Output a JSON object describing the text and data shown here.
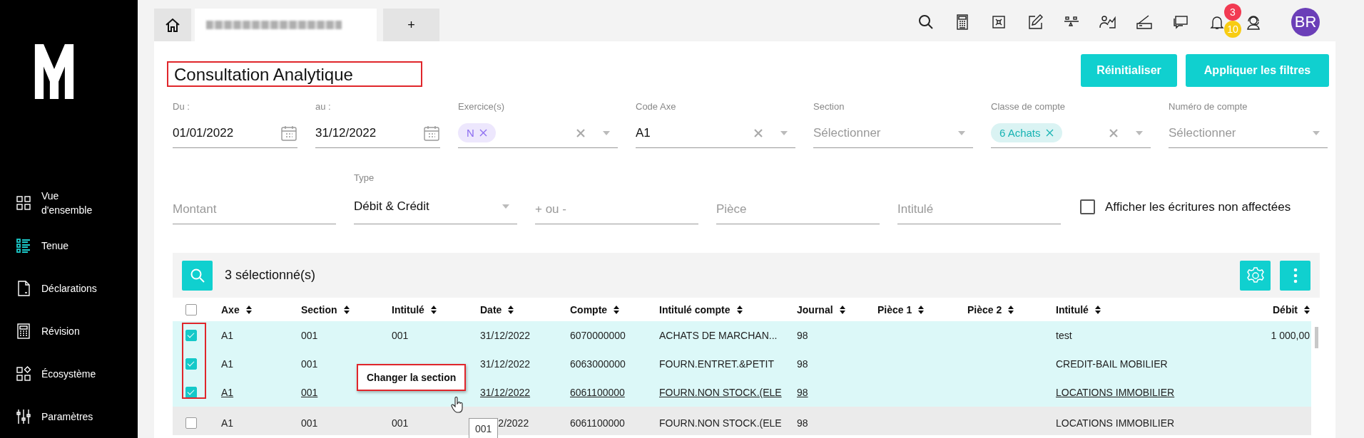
{
  "sidebar": {
    "nav": [
      {
        "label": "Vue d'ensemble",
        "selected": false
      },
      {
        "label": "Tenue",
        "selected": true
      },
      {
        "label": "Déclarations",
        "selected": false
      },
      {
        "label": "Révision",
        "selected": false
      },
      {
        "label": "Écosystème",
        "selected": false
      },
      {
        "label": "Paramètres",
        "selected": false
      }
    ]
  },
  "tabs": [
    {
      "kind": "home",
      "selected": false
    },
    {
      "kind": "document",
      "selected": true
    },
    {
      "kind": "new",
      "label": "+",
      "selected": false
    }
  ],
  "toolbar": {
    "notifications": [
      {
        "count": "3",
        "color": "#f23a52"
      },
      {
        "count": "10",
        "color": "#f8cc13"
      }
    ],
    "avatar": "BR"
  },
  "page": {
    "title": "Consultation Analytique",
    "title_highlighted": true,
    "buttons": [
      "Réinitialiser",
      "Appliquer les filtres"
    ]
  },
  "filters": [
    {
      "kind": "date",
      "label": "Du :",
      "value": "01/01/2022"
    },
    {
      "kind": "date",
      "label": "au :",
      "value": "31/12/2022"
    },
    {
      "kind": "multiselect",
      "label": "Exercice(s)",
      "chips": [
        {
          "text": "N",
          "color": "#8c6cf0"
        }
      ],
      "clearable": true
    },
    {
      "kind": "select",
      "label": "Code Axe",
      "value": "A1",
      "clearable": true
    },
    {
      "kind": "select",
      "label": "Section",
      "placeholder": "Sélectionner",
      "clearable": false
    },
    {
      "kind": "multiselect",
      "label": "Classe de compte",
      "chips": [
        {
          "text": "6 Achats",
          "color": "#17b3b3"
        }
      ],
      "clearable": true
    },
    {
      "kind": "select",
      "label": "Numéro de compte",
      "placeholder": "Sélectionner",
      "clearable": false
    }
  ],
  "filters_2": [
    {
      "kind": "text",
      "placeholder": "Montant"
    },
    {
      "kind": "select",
      "label": "Type",
      "value": "Débit & Crédit",
      "clearable": false
    },
    {
      "kind": "text",
      "placeholder": "+ ou -"
    },
    {
      "kind": "text",
      "placeholder": "Pièce"
    },
    {
      "kind": "text",
      "placeholder": "Intitulé"
    },
    {
      "kind": "checkbox",
      "label": "Afficher les écritures non affectées",
      "checked": false
    }
  ],
  "table": {
    "selection_text": "3 sélectionné(s)",
    "all_checked": false,
    "checkbox_column_highlighted": true,
    "columns": [
      "Axe",
      "Section",
      "Intitulé",
      "Date",
      "Compte",
      "Intitulé compte",
      "Journal",
      "Pièce 1",
      "Pièce 2",
      "Intitulé",
      "Débit"
    ],
    "rows": [
      {
        "checked": true,
        "hovered": false,
        "cells": [
          "A1",
          "001",
          "001",
          "31/12/2022",
          "6070000000",
          "ACHATS DE MARCHAN...",
          "98",
          null,
          null,
          "test",
          "1 000,00"
        ]
      },
      {
        "checked": true,
        "hovered": false,
        "cells": [
          "A1",
          "001",
          null,
          "31/12/2022",
          "6063000000",
          "FOURN.ENTRET.&PETIT",
          "98",
          null,
          null,
          "CREDIT-BAIL MOBILIER",
          null
        ]
      },
      {
        "checked": true,
        "hovered": true,
        "cells": [
          "A1",
          "001",
          null,
          "31/12/2022",
          "6061100000",
          "FOURN.NON STOCK.(ELE",
          "98",
          null,
          null,
          "LOCATIONS IMMOBILIER",
          null
        ]
      },
      {
        "checked": false,
        "hovered": false,
        "hint": "001",
        "cells": [
          "A1",
          "001",
          "001",
          "2/2022",
          "6061100000",
          "FOURN.NON STOCK.(ELE",
          "98",
          null,
          null,
          "LOCATIONS IMMOBILIER",
          null
        ]
      }
    ],
    "action_tooltip": {
      "text": "Changer la section",
      "highlighted": true
    }
  }
}
